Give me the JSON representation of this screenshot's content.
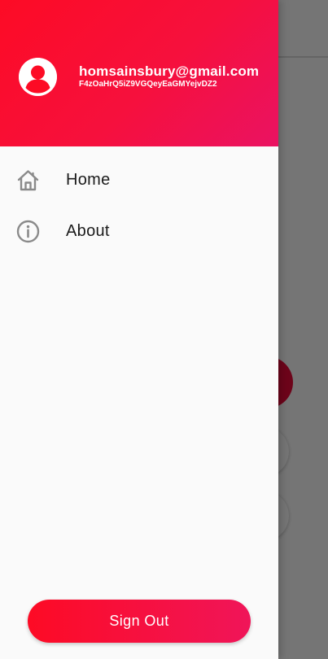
{
  "drawer": {
    "header": {
      "email": "homsainsbury@gmail.com",
      "user_id": "F4zOaHrQ5iZ9VGQeyEaGMYejvDZ2"
    },
    "items": [
      {
        "label": "Home",
        "icon": "home-icon"
      },
      {
        "label": "About",
        "icon": "info-icon"
      }
    ],
    "sign_out_label": "Sign Out"
  },
  "colors": {
    "gradient_start": "#fd0b25",
    "gradient_end": "#ea1262",
    "drawer_bg": "#fafafa",
    "scrim": "#757575",
    "icon_gray": "#8a8a8a"
  }
}
